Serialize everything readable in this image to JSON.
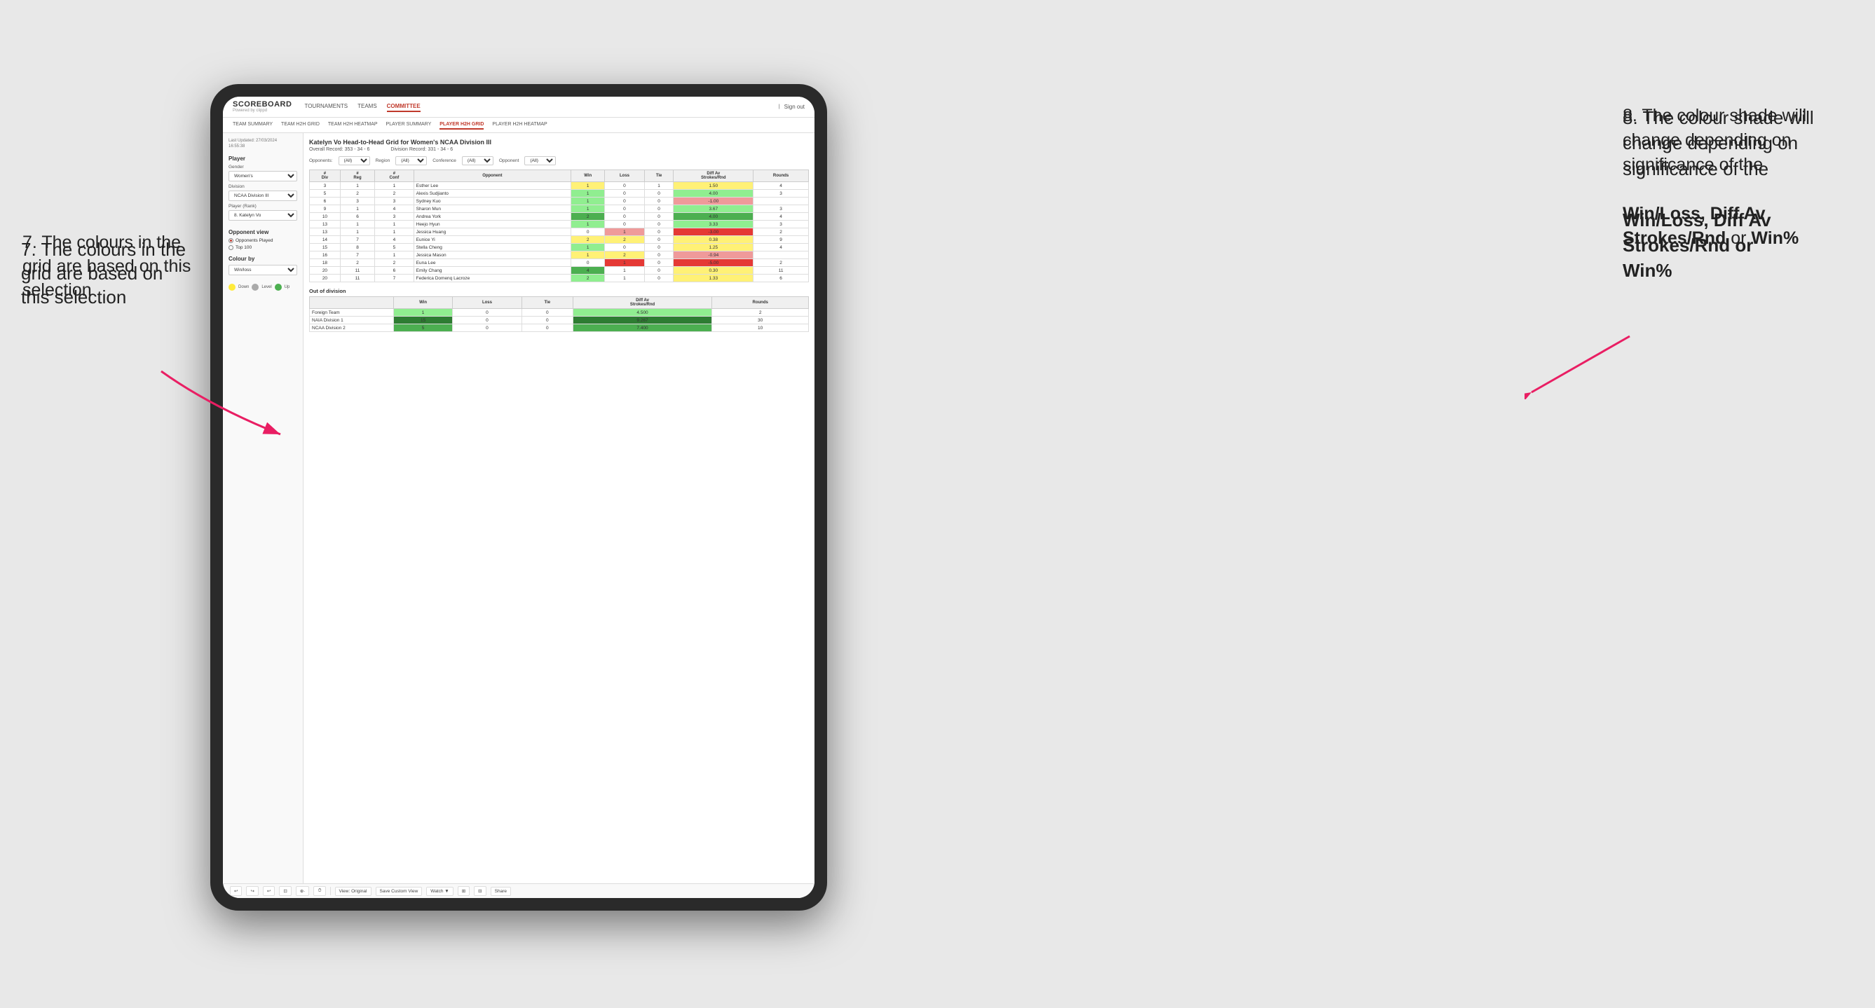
{
  "annotations": {
    "left_title": "7. The colours in the grid are based on this selection",
    "right_title": "8. The colour shade will change depending on significance of the",
    "right_bold1": "Win/Loss,",
    "right_bold2": "Diff Av Strokes/Rnd",
    "right_bold3": "or",
    "right_bold4": "Win%"
  },
  "app": {
    "logo": "SCOREBOARD",
    "logo_sub": "Powered by clippd",
    "sign_out": "Sign out"
  },
  "nav": {
    "items": [
      "TOURNAMENTS",
      "TEAMS",
      "COMMITTEE"
    ],
    "active": "COMMITTEE"
  },
  "subnav": {
    "items": [
      "TEAM SUMMARY",
      "TEAM H2H GRID",
      "TEAM H2H HEATMAP",
      "PLAYER SUMMARY",
      "PLAYER H2H GRID",
      "PLAYER H2H HEATMAP"
    ],
    "active": "PLAYER H2H GRID"
  },
  "sidebar": {
    "last_updated_label": "Last Updated: 27/03/2024",
    "last_updated_time": "16:55:38",
    "player_section": "Player",
    "gender_label": "Gender",
    "gender_value": "Women's",
    "division_label": "Division",
    "division_value": "NCAA Division III",
    "player_rank_label": "Player (Rank)",
    "player_rank_value": "8. Katelyn Vo",
    "opponent_view_label": "Opponent view",
    "opponent_option1": "Opponents Played",
    "opponent_option2": "Top 100",
    "colour_by_label": "Colour by",
    "colour_by_value": "Win/loss",
    "legend_down": "Down",
    "legend_level": "Level",
    "legend_up": "Up"
  },
  "grid": {
    "title": "Katelyn Vo Head-to-Head Grid for Women's NCAA Division III",
    "overall_record_label": "Overall Record:",
    "overall_record": "353 - 34 - 6",
    "division_record_label": "Division Record:",
    "division_record": "331 - 34 - 6",
    "opponents_label": "Opponents:",
    "opponents_value": "(All)",
    "region_label": "Region",
    "conference_label": "Conference",
    "conference_value": "(All)",
    "opponent_label": "Opponent",
    "opponent_value": "(All)",
    "col_div": "#\nDiv",
    "col_reg": "#\nReg",
    "col_conf": "#\nConf",
    "col_opponent": "Opponent",
    "col_win": "Win",
    "col_loss": "Loss",
    "col_tie": "Tie",
    "col_diff": "Diff Av\nStrokes/Rnd",
    "col_rounds": "Rounds",
    "rows": [
      {
        "div": "3",
        "reg": "1",
        "conf": "1",
        "opponent": "Esther Lee",
        "win": "1",
        "loss": "0",
        "tie": "1",
        "diff": "1.50",
        "rounds": "4"
      },
      {
        "div": "5",
        "reg": "2",
        "conf": "2",
        "opponent": "Alexis Sudjianto",
        "win": "1",
        "loss": "0",
        "tie": "0",
        "diff": "4.00",
        "rounds": "3"
      },
      {
        "div": "6",
        "reg": "3",
        "conf": "3",
        "opponent": "Sydney Kuo",
        "win": "1",
        "loss": "0",
        "tie": "0",
        "diff": "-1.00",
        "rounds": ""
      },
      {
        "div": "9",
        "reg": "1",
        "conf": "4",
        "opponent": "Sharon Mun",
        "win": "1",
        "loss": "0",
        "tie": "0",
        "diff": "3.67",
        "rounds": "3"
      },
      {
        "div": "10",
        "reg": "6",
        "conf": "3",
        "opponent": "Andrea York",
        "win": "2",
        "loss": "0",
        "tie": "0",
        "diff": "4.00",
        "rounds": "4"
      },
      {
        "div": "13",
        "reg": "1",
        "conf": "1",
        "opponent": "Heejo Hyun",
        "win": "1",
        "loss": "0",
        "tie": "0",
        "diff": "3.33",
        "rounds": "3"
      },
      {
        "div": "13",
        "reg": "1",
        "conf": "1",
        "opponent": "Jessica Huang",
        "win": "0",
        "loss": "1",
        "tie": "0",
        "diff": "-3.00",
        "rounds": "2"
      },
      {
        "div": "14",
        "reg": "7",
        "conf": "4",
        "opponent": "Eunice Yi",
        "win": "2",
        "loss": "2",
        "tie": "0",
        "diff": "0.38",
        "rounds": "9"
      },
      {
        "div": "15",
        "reg": "8",
        "conf": "5",
        "opponent": "Stella Cheng",
        "win": "1",
        "loss": "0",
        "tie": "0",
        "diff": "1.25",
        "rounds": "4"
      },
      {
        "div": "16",
        "reg": "7",
        "conf": "1",
        "opponent": "Jessica Mason",
        "win": "1",
        "loss": "2",
        "tie": "0",
        "diff": "-0.94",
        "rounds": ""
      },
      {
        "div": "18",
        "reg": "2",
        "conf": "2",
        "opponent": "Euna Lee",
        "win": "0",
        "loss": "1",
        "tie": "0",
        "diff": "-5.00",
        "rounds": "2"
      },
      {
        "div": "20",
        "reg": "11",
        "conf": "6",
        "opponent": "Emily Chang",
        "win": "4",
        "loss": "1",
        "tie": "0",
        "diff": "0.30",
        "rounds": "11"
      },
      {
        "div": "20",
        "reg": "11",
        "conf": "7",
        "opponent": "Federica Domenq Lacroze",
        "win": "2",
        "loss": "1",
        "tie": "0",
        "diff": "1.33",
        "rounds": "6"
      }
    ],
    "out_of_division_label": "Out of division",
    "out_of_division_rows": [
      {
        "opponent": "Foreign Team",
        "win": "1",
        "loss": "0",
        "tie": "0",
        "diff": "4.500",
        "rounds": "2"
      },
      {
        "opponent": "NAIA Division 1",
        "win": "15",
        "loss": "0",
        "tie": "0",
        "diff": "9.267",
        "rounds": "30"
      },
      {
        "opponent": "NCAA Division 2",
        "win": "5",
        "loss": "0",
        "tie": "0",
        "diff": "7.400",
        "rounds": "10"
      }
    ]
  },
  "toolbar": {
    "undo": "↩",
    "redo": "↪",
    "view_original": "View: Original",
    "save_custom": "Save Custom View",
    "watch": "Watch ▼",
    "share": "Share"
  }
}
